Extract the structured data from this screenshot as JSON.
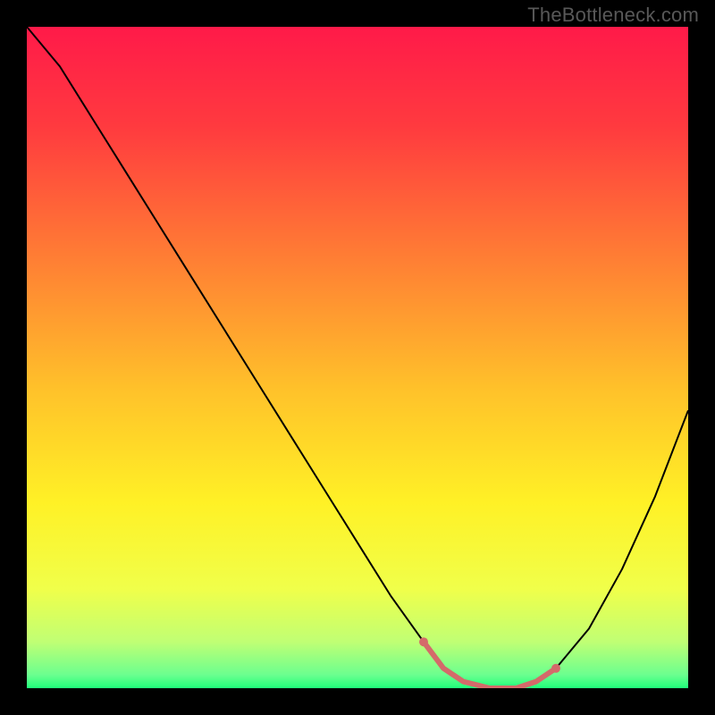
{
  "watermark": "TheBottleneck.com",
  "chart_data": {
    "type": "line",
    "title": "",
    "xlabel": "",
    "ylabel": "",
    "xlim": [
      0,
      100
    ],
    "ylim": [
      0,
      100
    ],
    "x": [
      0,
      5,
      10,
      15,
      20,
      25,
      30,
      35,
      40,
      45,
      50,
      55,
      60,
      63,
      66,
      70,
      74,
      77,
      80,
      85,
      90,
      95,
      100
    ],
    "values": [
      100,
      94,
      86,
      78,
      70,
      62,
      54,
      46,
      38,
      30,
      22,
      14,
      7,
      3,
      1,
      0,
      0,
      1,
      3,
      9,
      18,
      29,
      42
    ],
    "highlight_segments": [
      {
        "x": [
          60,
          63,
          66,
          70,
          74,
          77,
          80
        ],
        "y": [
          7,
          3,
          1,
          0,
          0,
          1,
          3
        ]
      }
    ],
    "gradient_stops": [
      {
        "offset": 0.0,
        "color": "#ff1a49"
      },
      {
        "offset": 0.15,
        "color": "#ff3a3f"
      },
      {
        "offset": 0.35,
        "color": "#ff7e34"
      },
      {
        "offset": 0.55,
        "color": "#ffc22a"
      },
      {
        "offset": 0.72,
        "color": "#fff126"
      },
      {
        "offset": 0.85,
        "color": "#f0ff4a"
      },
      {
        "offset": 0.93,
        "color": "#c0ff74"
      },
      {
        "offset": 0.98,
        "color": "#6bff8f"
      },
      {
        "offset": 1.0,
        "color": "#1fff7a"
      }
    ],
    "curve_style": {
      "stroke": "#000000",
      "width": 2
    },
    "highlight_style": {
      "stroke": "#d46a6a",
      "width": 6,
      "endpoint_radius": 5,
      "endpoint_fill": "#d46a6a"
    }
  }
}
